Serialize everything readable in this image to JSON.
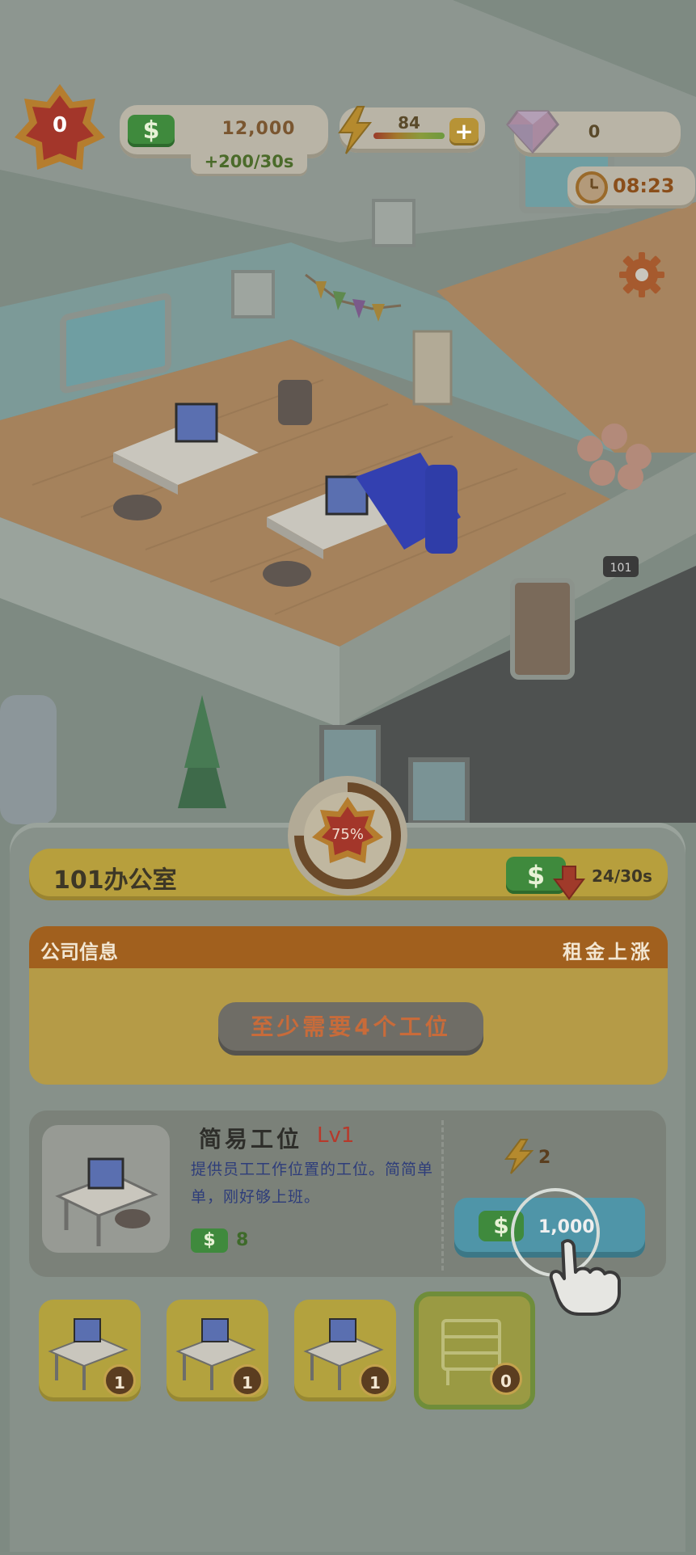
{
  "hud": {
    "level": "0",
    "cash": "12,000",
    "income": "+200/30s",
    "energy": "84",
    "gems": "0",
    "timer": "08:23"
  },
  "scene": {
    "door_plate": "101"
  },
  "office": {
    "name": "101办公室",
    "progress": "75%",
    "rent": "24/30s",
    "info_title": "公司信息",
    "info_right": "租金上涨",
    "requirement": "至少需要4个工位"
  },
  "item": {
    "name": "简易工位",
    "level": "Lv1",
    "description": "提供员工工作位置的工位。简简单单，刚好够上班。",
    "income": "8",
    "energy_cost": "2",
    "price": "1,000",
    "currency_symbol": "$"
  },
  "slots": [
    {
      "count": "1"
    },
    {
      "count": "1"
    },
    {
      "count": "1"
    },
    {
      "count": "0"
    }
  ],
  "colors": {
    "accent_green": "#3f8a3d",
    "buy_button": "#4f95a8",
    "title_bar": "#b79f3d",
    "info_header": "#a1601e"
  }
}
